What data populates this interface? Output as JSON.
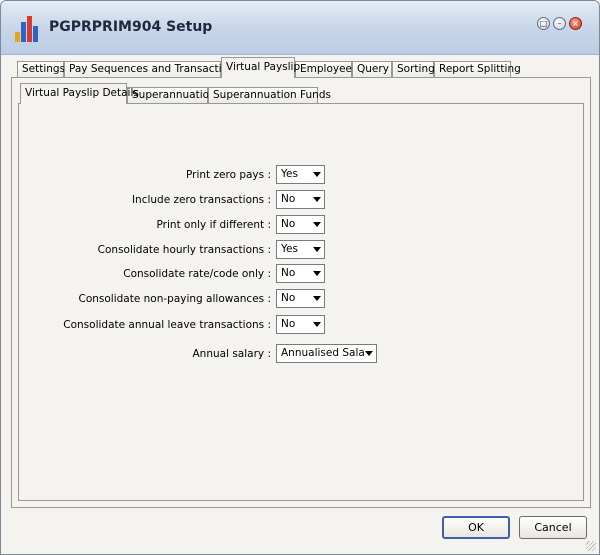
{
  "window": {
    "title": "PGPRPRIM904 Setup"
  },
  "top_tabs": [
    {
      "label": "Settings"
    },
    {
      "label": "Pay Sequences and Transactions"
    },
    {
      "label": "Virtual Payslip"
    },
    {
      "label": "Employees"
    },
    {
      "label": "Query"
    },
    {
      "label": "Sorting"
    },
    {
      "label": "Report Splitting"
    }
  ],
  "active_top_tab": "Virtual Payslip",
  "sub_tabs": [
    {
      "label": "Virtual Payslip Details"
    },
    {
      "label": "Superannuation"
    },
    {
      "label": "Superannuation Funds"
    }
  ],
  "active_sub_tab": "Virtual Payslip Details",
  "fields": [
    {
      "label": "Print zero pays :",
      "value": "Yes"
    },
    {
      "label": "Include zero transactions :",
      "value": "No"
    },
    {
      "label": "Print only if different :",
      "value": "No"
    },
    {
      "label": "Consolidate hourly transactions :",
      "value": "Yes"
    },
    {
      "label": "Consolidate rate/code only :",
      "value": "No"
    },
    {
      "label": "Consolidate non-paying allowances :",
      "value": "No"
    },
    {
      "label": "Consolidate annual leave transactions :",
      "value": "No"
    },
    {
      "label": "Annual salary :",
      "value": "Annualised Salary"
    }
  ],
  "buttons": {
    "ok": "OK",
    "cancel": "Cancel"
  }
}
